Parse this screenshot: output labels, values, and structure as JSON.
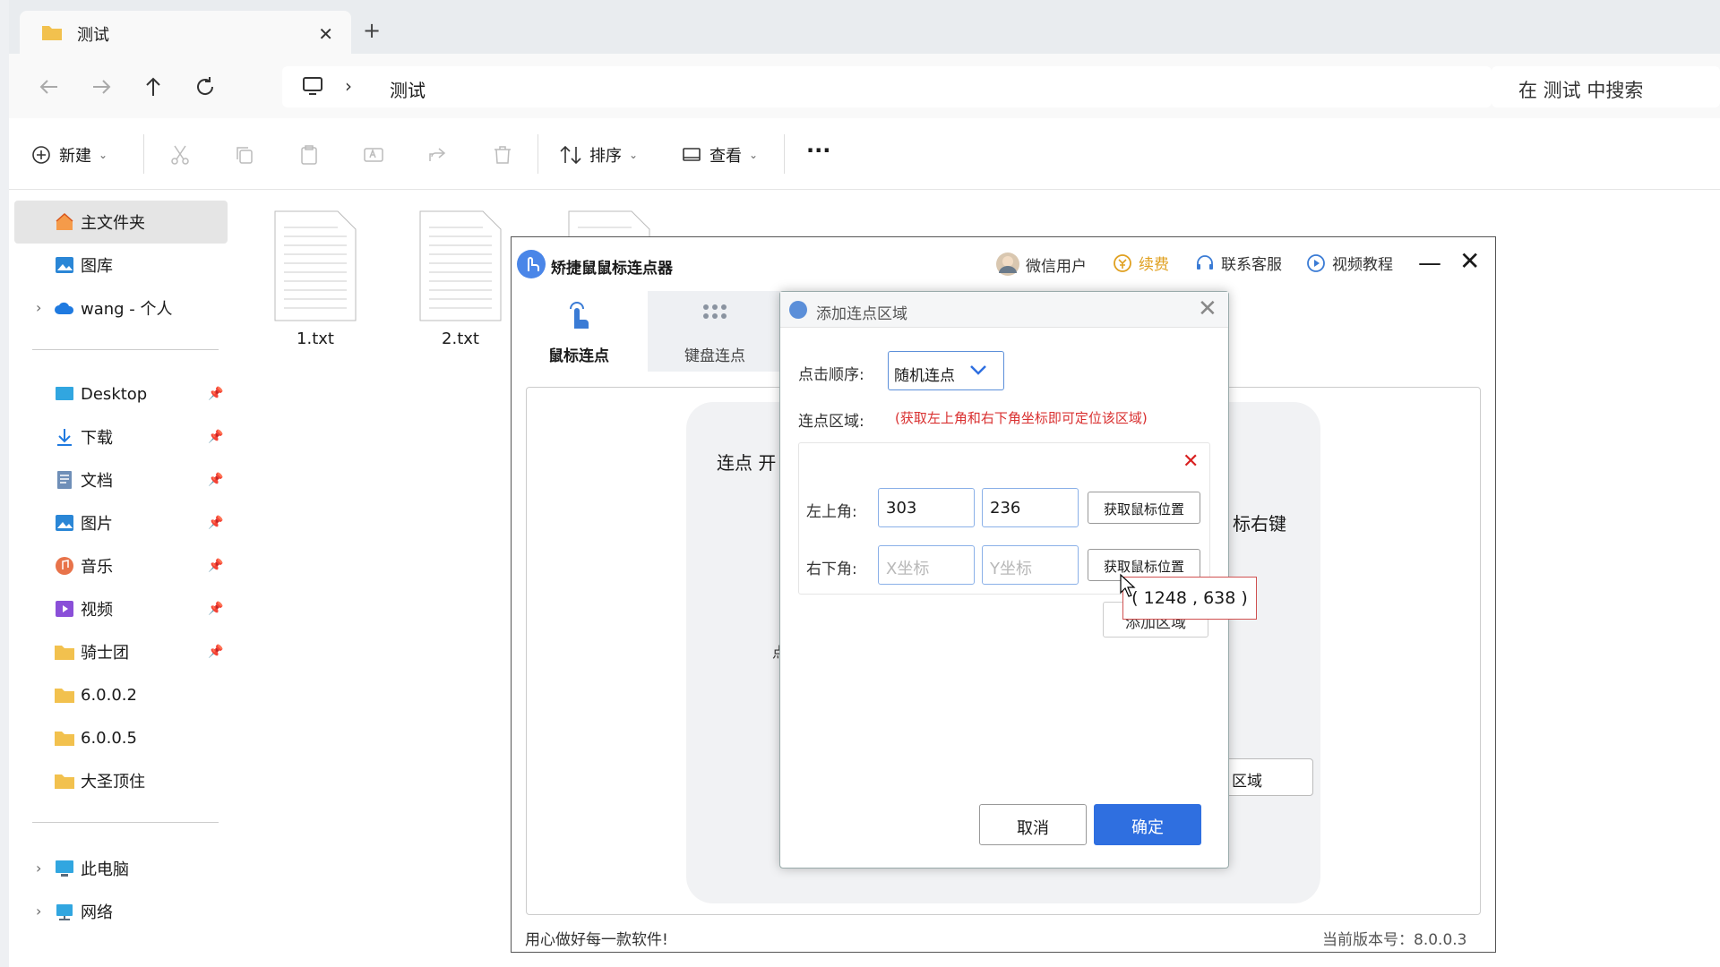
{
  "explorer": {
    "tab_title": "测试",
    "tab_close": "✕",
    "new_tab": "+",
    "path_sep": "›",
    "path": "测试",
    "search_placeholder": "在 测试 中搜索",
    "cmd": {
      "new": "新建",
      "sort": "排序",
      "view": "查看",
      "more": "···"
    },
    "sidebar": {
      "home": "主文件夹",
      "gallery": "图库",
      "onedrive": "wang - 个人",
      "quick": [
        "Desktop",
        "下载",
        "文档",
        "图片",
        "音乐",
        "视频",
        "骑士团",
        "6.0.0.2",
        "6.0.0.5",
        "大圣顶住"
      ],
      "pc": "此电脑",
      "network": "网络"
    },
    "files": [
      "1.txt",
      "2.txt"
    ]
  },
  "app": {
    "title": "矫捷鼠鼠标连点器",
    "header": {
      "user": "微信用户",
      "renew": "续费",
      "service": "联系客服",
      "video": "视频教程"
    },
    "tabs": {
      "mouse": "鼠标连点",
      "keyboard": "键盘连点"
    },
    "card": {
      "label1": "连点 开",
      "label2": "标右键",
      "label3": "点",
      "btn": "区域"
    },
    "footer_left": "用心做好每一款软件!",
    "footer_right": "当前版本号：8.0.0.3"
  },
  "dialog": {
    "title": "添加连点区域",
    "close": "✕",
    "order_label": "点击顺序:",
    "order_value": "随机连点",
    "area_label": "连点区域:",
    "hint": "(获取左上角和右下角坐标即可定位该区域)",
    "delete": "✕",
    "top_left_label": "左上角:",
    "top_left_x": "303",
    "top_left_y": "236",
    "bottom_right_label": "右下角:",
    "bottom_right_x_placeholder": "X坐标",
    "bottom_right_y_placeholder": "Y坐标",
    "get_pos": "获取鼠标位置",
    "add_area": "添加区域",
    "tooltip": "( 1248 , 638 )",
    "cancel": "取消",
    "ok": "确定"
  },
  "colors": {
    "accent": "#2f6fe0",
    "hint": "#d93030",
    "folder": "#f2c14e"
  }
}
